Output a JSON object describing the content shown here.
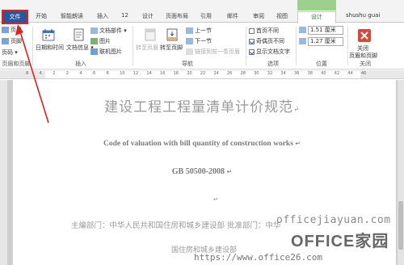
{
  "tabs": {
    "file": "文件",
    "start": "开始",
    "reading": "智能朗读",
    "insert": "插入",
    "num12": "12",
    "design": "设计",
    "layout": "页面布局",
    "references": "引用",
    "mail": "邮件",
    "review": "审阅",
    "view": "视图",
    "header_design": "设计",
    "user": "shushu guai"
  },
  "ribbon": {
    "left_items": [
      "页眉",
      "页脚",
      "页码"
    ],
    "left_group": "页眉和页脚",
    "datetime": "日期和时间",
    "docinfo": "文档信息",
    "docparts": "文档部件",
    "picture": "图片",
    "online_picture": "联机图片",
    "insert_group": "插入",
    "goto_header": "转至页眉",
    "goto_footer": "转至页脚",
    "prev_section": "上一节",
    "next_section": "下一节",
    "link_prev": "链接到前一条页眉",
    "nav_group": "导航",
    "diff_first": "首页不同",
    "diff_odd_even": "奇偶页不同",
    "show_doc_text": "显示文档文字",
    "options_group": "选项",
    "header_pos": "1.51 厘米",
    "footer_pos": "1.27 厘米",
    "position_group": "位置",
    "close_label_1": "关闭",
    "close_label_2": "页眉和页脚",
    "close_group": "关闭"
  },
  "ruler_numbers": [
    "8",
    "4",
    "2",
    "2",
    "4",
    "6",
    "8",
    "10",
    "12",
    "14",
    "16",
    "18",
    "20",
    "22",
    "24",
    "26",
    "28",
    "30",
    "32",
    "34",
    "36",
    "38",
    "40",
    "42",
    "44",
    "46"
  ],
  "document": {
    "title_cn": "建设工程工程量清单计价规范",
    "title_en": "Code of valuation with bill quantity of construction works",
    "gb": "GB 50500-2008",
    "dept": "主编部门：中华人民共和国住房和城乡建设部 批准部门：中华",
    "dept2": "国住房和城乡建设部",
    "para_mark": "↵"
  },
  "watermark": {
    "url": "officejiayuan.com",
    "brand": "OFFICE家园",
    "url2": "https://www.office26.com"
  },
  "colors": {
    "file_tab": "#2b579a",
    "annotation": "#e02020",
    "context_tab": "#9bd08f"
  }
}
